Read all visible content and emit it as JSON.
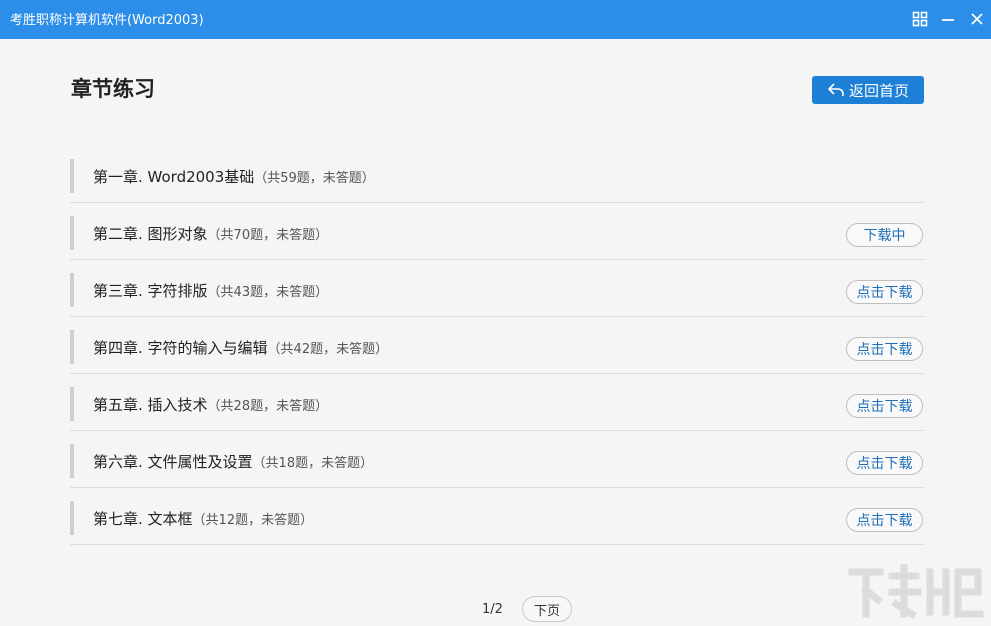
{
  "window": {
    "title": "考胜职称计算机软件(Word2003)",
    "controls": [
      "grid-icon",
      "minimize-icon",
      "close-icon"
    ]
  },
  "page": {
    "title": "章节练习",
    "back_button": "返回首页"
  },
  "chapters": [
    {
      "label": "第一章. Word2003基础",
      "info": "（共59题，未答题）",
      "action": ""
    },
    {
      "label": "第二章. 图形对象",
      "info": "（共70题，未答题）",
      "action": "下载中"
    },
    {
      "label": "第三章. 字符排版",
      "info": "（共43题，未答题）",
      "action": "点击下载"
    },
    {
      "label": "第四章. 字符的输入与编辑",
      "info": "（共42题，未答题）",
      "action": "点击下载"
    },
    {
      "label": "第五章. 插入技术",
      "info": "（共28题，未答题）",
      "action": "点击下载"
    },
    {
      "label": "第六章. 文件属性及设置",
      "info": "（共18题，未答题）",
      "action": "点击下载"
    },
    {
      "label": "第七章. 文本框",
      "info": "（共12题，未答题）",
      "action": "点击下载"
    }
  ],
  "pager": {
    "page_indicator": "1/2",
    "next_label": "下页"
  },
  "colors": {
    "titlebar": "#2c8ee8",
    "primary_button": "#1e7fd6",
    "link_text": "#1f6fb8",
    "background": "#f5f5f5"
  }
}
